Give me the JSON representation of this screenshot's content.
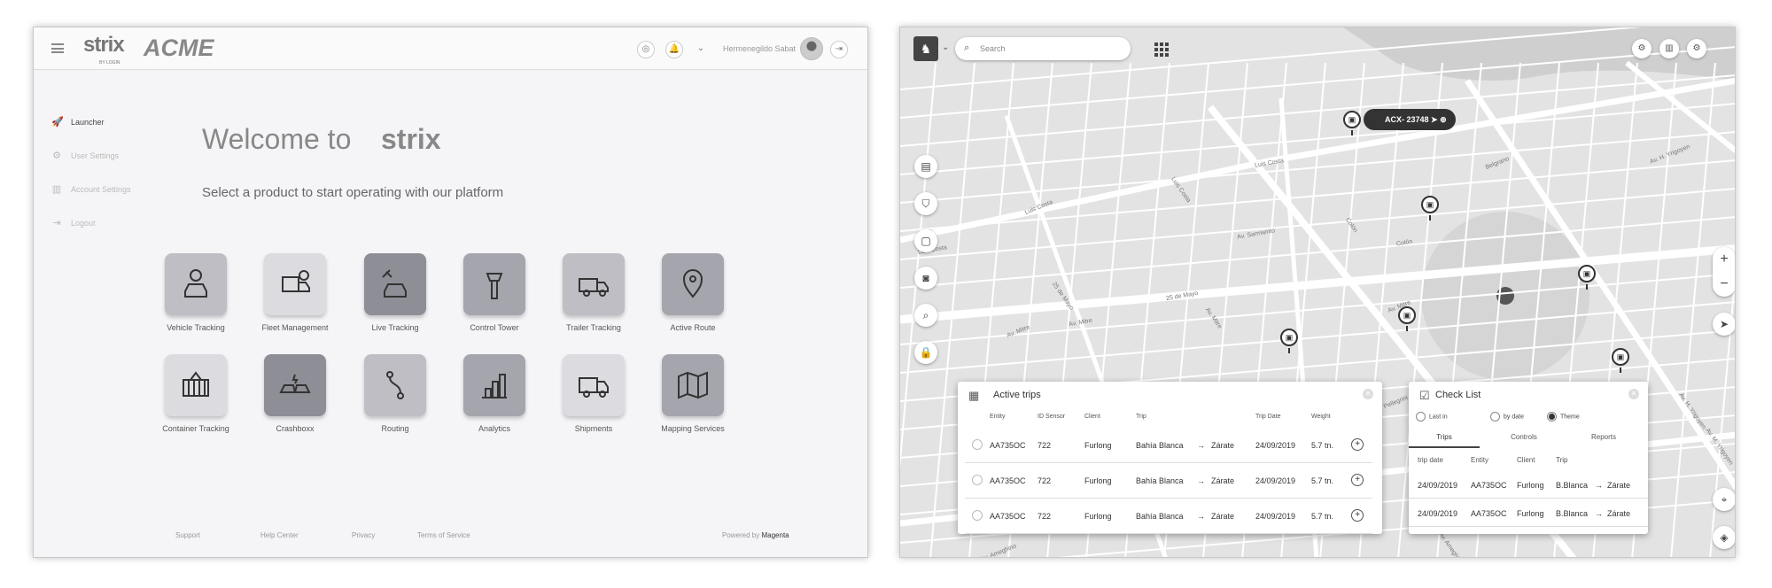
{
  "left": {
    "brand_main": "strix",
    "brand_sub": "BY LOGIN",
    "brand_client": "ACME",
    "user_name": "Hermenegildo Sabat",
    "nav": [
      {
        "label": "Launcher",
        "icon": "rocket-icon"
      },
      {
        "label": "User Settings",
        "icon": "user-settings-icon"
      },
      {
        "label": "Account Settings",
        "icon": "building-icon"
      },
      {
        "label": "Logout",
        "icon": "logout-icon"
      }
    ],
    "welcome_prefix": "Welcome to",
    "welcome_brand": "strix",
    "subtitle": "Select a product to start operating with our platform",
    "products": [
      {
        "label": "Vehicle Tracking",
        "icon": "car-target-icon",
        "shade": "light"
      },
      {
        "label": "Fleet Management",
        "icon": "truck-gear-icon",
        "shade": "lighter"
      },
      {
        "label": "Live Tracking",
        "icon": "car-satellite-icon",
        "shade": "dark"
      },
      {
        "label": "Control Tower",
        "icon": "control-tower-icon",
        "shade": "mid"
      },
      {
        "label": "Trailer Tracking",
        "icon": "trailer-icon",
        "shade": "light"
      },
      {
        "label": "Active Route",
        "icon": "map-pin-icon",
        "shade": "mid"
      },
      {
        "label": "Container Tracking",
        "icon": "container-icon",
        "shade": "lighter"
      },
      {
        "label": "Crashboxx",
        "icon": "crash-icon",
        "shade": "dark"
      },
      {
        "label": "Routing",
        "icon": "route-icon",
        "shade": "light"
      },
      {
        "label": "Analytics",
        "icon": "analytics-icon",
        "shade": "mid"
      },
      {
        "label": "Shipments",
        "icon": "shipment-truck-icon",
        "shade": "lighter"
      },
      {
        "label": "Mapping Services",
        "icon": "map-icon",
        "shade": "mid"
      }
    ],
    "footer": {
      "support": "Support",
      "help": "Help Center",
      "privacy": "Privacy",
      "terms": "Terms of Service",
      "powered_prefix": "Powered by",
      "powered_brand": "Magenta"
    }
  },
  "right": {
    "search_placeholder": "Search",
    "vehicle_label": "ACX- 23748",
    "streets": [
      "Luis Costa",
      "Luis Costa",
      "Luis Costa",
      "Luis Costa",
      "Av. Mitre",
      "Av. Mitre",
      "Av. Mitre",
      "Av. Mitre",
      "25 de Mayo",
      "25 de Mayo",
      "Av. Ameghino",
      "Av. Ameghino",
      "Av. Ameghino",
      "Av. H. Yrigoyen",
      "Av. H. Yrigoyen",
      "Av. Sarmiento",
      "Pellegrini",
      "Colón",
      "Colón",
      "Belgrano",
      "Av. M. Yrigoyen"
    ],
    "active_trips": {
      "title": "Active trips",
      "headers": [
        "Entity",
        "ID Sensor",
        "Client",
        "Trip",
        "Trip Date",
        "Weight"
      ],
      "rows": [
        {
          "entity": "AA735OC",
          "sensor": "722",
          "client": "Furlong",
          "from": "Bahía Blanca",
          "to": "Zárate",
          "date": "24/09/2019",
          "weight": "5.7 tn."
        },
        {
          "entity": "AA735OC",
          "sensor": "722",
          "client": "Furlong",
          "from": "Bahía Blanca",
          "to": "Zárate",
          "date": "24/09/2019",
          "weight": "5.7 tn."
        },
        {
          "entity": "AA735OC",
          "sensor": "722",
          "client": "Furlong",
          "from": "Bahía Blanca",
          "to": "Zárate",
          "date": "24/09/2019",
          "weight": "5.7 tn."
        }
      ]
    },
    "checklist": {
      "title": "Check List",
      "radios": [
        "Last in",
        "by date",
        "Theme"
      ],
      "selected_radio": "Theme",
      "tabs": [
        "Trips",
        "Controls",
        "Reports"
      ],
      "active_tab": "Trips",
      "headers": [
        "trip date",
        "Entity",
        "Client",
        "Trip"
      ],
      "rows": [
        {
          "date": "24/09/2019",
          "entity": "AA735OC",
          "client": "Furlong",
          "from": "B.Blanca",
          "to": "Zárate"
        },
        {
          "date": "24/09/2019",
          "entity": "AA735OC",
          "client": "Furlong",
          "from": "B.Blanca",
          "to": "Zárate"
        }
      ]
    }
  }
}
